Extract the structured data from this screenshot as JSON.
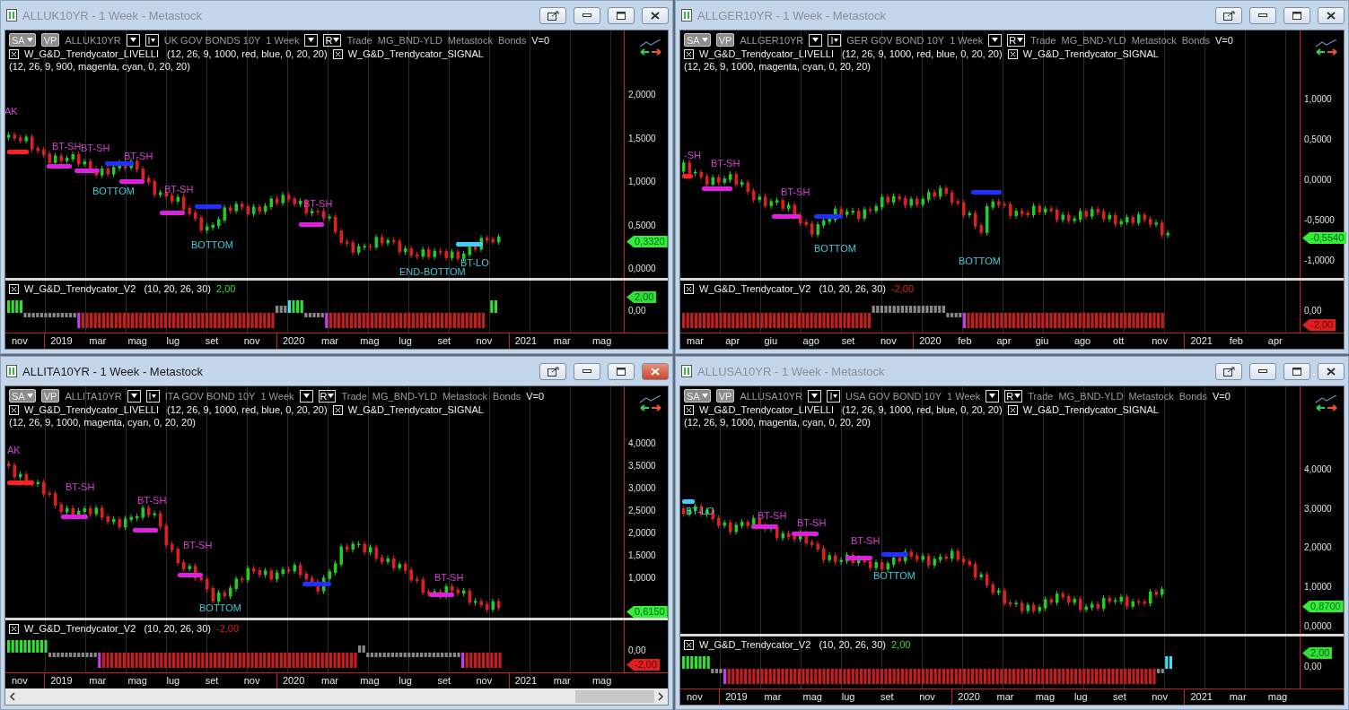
{
  "windows": [
    {
      "title": "ALLUK10YR - 1 Week - Metastock",
      "active": false,
      "scrollbar": false,
      "symbol_bar": {
        "sa": "SA",
        "vp": "VP",
        "symbol": "ALLUK10YR",
        "name": "UK GOV BONDS 10Y",
        "period": "1 Week",
        "r": "R",
        "tags": [
          "Trade",
          "MG_BND-YLD",
          "Metastock",
          "Bonds"
        ],
        "v": "V=0"
      },
      "indicators": [
        {
          "name": "W_G&D_Trendycator_LIVELLI",
          "params": "(12, 26, 9, 1000, red, blue, 0, 20, 20)"
        },
        {
          "name": "W_G&D_Trendycator_SIGNAL",
          "params": "(12, 26, 9, 900, magenta, cyan, 0, 20, 20)"
        }
      ],
      "price_axis": [
        "2,0000",
        "1,5000",
        "1,0000",
        "0,5000",
        "0,0000"
      ],
      "last_price": "0,3320",
      "annotations": [
        {
          "text": "AK",
          "color": "#d040d0"
        },
        {
          "text": "BT-SH",
          "color": "#d040d0"
        },
        {
          "text": "BT-SH",
          "color": "#d040d0"
        },
        {
          "text": "BT-SH",
          "color": "#d040d0"
        },
        {
          "text": "BOTTOM",
          "color": "#40c8d8"
        },
        {
          "text": "BT-SH",
          "color": "#d040d0"
        },
        {
          "text": "BOTTOM",
          "color": "#40c8d8"
        },
        {
          "text": "BT-SH",
          "color": "#d040d0"
        },
        {
          "text": "END-BOTTOM",
          "color": "#40c8d8"
        },
        {
          "text": "BT-LO",
          "color": "#40c8d8"
        }
      ],
      "oscillator": {
        "name": "W_G&D_Trendycator_V2",
        "params": "(10, 20, 26, 30)",
        "value": "2,00",
        "color": "#33dd33",
        "axis": "0,00",
        "badge": "2,00"
      },
      "months": [
        {
          "label": "nov",
          "kind": "month"
        },
        {
          "label": "2019",
          "kind": "year"
        },
        {
          "label": "mar",
          "kind": "month"
        },
        {
          "label": "mag",
          "kind": "month"
        },
        {
          "label": "lug",
          "kind": "month"
        },
        {
          "label": "set",
          "kind": "month"
        },
        {
          "label": "nov",
          "kind": "month"
        },
        {
          "label": "2020",
          "kind": "year"
        },
        {
          "label": "mar",
          "kind": "month"
        },
        {
          "label": "mag",
          "kind": "month"
        },
        {
          "label": "lug",
          "kind": "month"
        },
        {
          "label": "set",
          "kind": "month"
        },
        {
          "label": "nov",
          "kind": "month"
        },
        {
          "label": "2021",
          "kind": "year"
        },
        {
          "label": "mar",
          "kind": "month"
        },
        {
          "label": "mag",
          "kind": "month"
        }
      ]
    },
    {
      "title": "ALLGER10YR - 1 Week - Metastock",
      "active": false,
      "scrollbar": false,
      "symbol_bar": {
        "sa": "SA",
        "vp": "VP",
        "symbol": "ALLGER10YR",
        "name": "GER GOV BOND 10Y",
        "period": "1 Week",
        "r": "R",
        "tags": [
          "Trade",
          "MG_BND-YLD",
          "Metastock",
          "Bonds"
        ],
        "v": "V=0"
      },
      "indicators": [
        {
          "name": "W_G&D_Trendycator_LIVELLI",
          "params": "(12, 26, 9, 1000, red, blue, 0, 20, 20)"
        },
        {
          "name": "W_G&D_Trendycator_SIGNAL",
          "params": "(12, 26, 9, 1000, magenta, cyan, 0, 20, 20)"
        }
      ],
      "price_axis": [
        "1,0000",
        "0,5000",
        "0,0000",
        "-0,5000",
        "-1,0000"
      ],
      "last_price": "-0,5540",
      "annotations": [
        {
          "text": "-SH",
          "color": "#d040d0"
        },
        {
          "text": "BT-SH",
          "color": "#d040d0"
        },
        {
          "text": "BT-SH",
          "color": "#d040d0"
        },
        {
          "text": "BOTTOM",
          "color": "#40c8d8"
        },
        {
          "text": "BOTTOM",
          "color": "#40c8d8"
        }
      ],
      "oscillator": {
        "name": "W_G&D_Trendycator_V2",
        "params": "(10, 20, 26, 30)",
        "value": "-2,00",
        "color": "#e02020",
        "axis": "0,00",
        "badge": "-2,00"
      },
      "months": [
        {
          "label": "mar",
          "kind": "month"
        },
        {
          "label": "apr",
          "kind": "month"
        },
        {
          "label": "giu",
          "kind": "month"
        },
        {
          "label": "ago",
          "kind": "month"
        },
        {
          "label": "set",
          "kind": "month"
        },
        {
          "label": "nov",
          "kind": "month"
        },
        {
          "label": "2020",
          "kind": "year"
        },
        {
          "label": "feb",
          "kind": "month"
        },
        {
          "label": "apr",
          "kind": "month"
        },
        {
          "label": "giu",
          "kind": "month"
        },
        {
          "label": "ago",
          "kind": "month"
        },
        {
          "label": "ott",
          "kind": "month"
        },
        {
          "label": "nov",
          "kind": "month"
        },
        {
          "label": "2021",
          "kind": "year"
        },
        {
          "label": "feb",
          "kind": "month"
        },
        {
          "label": "apr",
          "kind": "month"
        }
      ]
    },
    {
      "title": "ALLITA10YR - 1 Week - Metastock",
      "active": true,
      "scrollbar": true,
      "symbol_bar": {
        "sa": "SA",
        "vp": "VP",
        "symbol": "ALLITA10YR",
        "name": "ITA GOV BOND 10Y",
        "period": "1 Week",
        "r": "R",
        "tags": [
          "Trade",
          "MG_BND-YLD",
          "Metastock",
          "Bonds"
        ],
        "v": "V=0"
      },
      "indicators": [
        {
          "name": "W_G&D_Trendycator_LIVELLI",
          "params": "(12, 26, 9, 1000, red, blue, 0, 20, 20)"
        },
        {
          "name": "W_G&D_Trendycator_SIGNAL",
          "params": "(12, 26, 9, 1000, magenta, cyan, 0, 20, 20)"
        }
      ],
      "price_axis": [
        "4,0000",
        "3,5000",
        "3,0000",
        "2,5000",
        "2,0000",
        "1,5000",
        "1,0000"
      ],
      "last_price": "0,6150",
      "annotations": [
        {
          "text": "AK",
          "color": "#d040d0"
        },
        {
          "text": "BT-SH",
          "color": "#d040d0"
        },
        {
          "text": "BT-SH",
          "color": "#d040d0"
        },
        {
          "text": "BT-SH",
          "color": "#d040d0"
        },
        {
          "text": "BOTTOM",
          "color": "#40c8d8"
        },
        {
          "text": "BT-SH",
          "color": "#d040d0"
        }
      ],
      "oscillator": {
        "name": "W_G&D_Trendycator_V2",
        "params": "(10, 20, 26, 30)",
        "value": "-2,00",
        "color": "#e02020",
        "axis": "0,00",
        "badge": "-2,00"
      },
      "months": [
        {
          "label": "nov",
          "kind": "month"
        },
        {
          "label": "2019",
          "kind": "year"
        },
        {
          "label": "mar",
          "kind": "month"
        },
        {
          "label": "mag",
          "kind": "month"
        },
        {
          "label": "lug",
          "kind": "month"
        },
        {
          "label": "set",
          "kind": "month"
        },
        {
          "label": "nov",
          "kind": "month"
        },
        {
          "label": "2020",
          "kind": "year"
        },
        {
          "label": "mar",
          "kind": "month"
        },
        {
          "label": "mag",
          "kind": "month"
        },
        {
          "label": "lug",
          "kind": "month"
        },
        {
          "label": "set",
          "kind": "month"
        },
        {
          "label": "nov",
          "kind": "month"
        },
        {
          "label": "2021",
          "kind": "year"
        },
        {
          "label": "mar",
          "kind": "month"
        },
        {
          "label": "mag",
          "kind": "month"
        }
      ]
    },
    {
      "title": "ALLUSA10YR - 1 Week - Metastock",
      "active": false,
      "scrollbar": false,
      "symbol_bar": {
        "sa": "SA",
        "vp": "VP",
        "symbol": "ALLUSA10YR",
        "name": "USA GOV BOND 10Y",
        "period": "1 Week",
        "r": "R",
        "tags": [
          "Trade",
          "MG_BND-YLD",
          "Metastock",
          "Bonds"
        ],
        "v": "V=0"
      },
      "indicators": [
        {
          "name": "W_G&D_Trendycator_LIVELLI",
          "params": "(12, 26, 9, 1000, red, blue, 0, 20, 20)"
        },
        {
          "name": "W_G&D_Trendycator_SIGNAL",
          "params": "(12, 26, 9, 1000, magenta, cyan, 0, 20, 20)"
        }
      ],
      "price_axis": [
        "4,0000",
        "3,0000",
        "2,0000",
        "1,0000",
        "0,0000"
      ],
      "last_price": "0,8700",
      "annotations": [
        {
          "text": "BT-LO",
          "color": "#40c8d8"
        },
        {
          "text": "BT-SH",
          "color": "#d040d0"
        },
        {
          "text": "BT-SH",
          "color": "#d040d0"
        },
        {
          "text": "BT-SH",
          "color": "#d040d0"
        },
        {
          "text": "BOTTOM",
          "color": "#40c8d8"
        }
      ],
      "oscillator": {
        "name": "W_G&D_Trendycator_V2",
        "params": "(10, 20, 26, 30)",
        "value": "2,00",
        "color": "#33dd33",
        "axis": "0,00",
        "badge": "2,00"
      },
      "months": [
        {
          "label": "nov",
          "kind": "month"
        },
        {
          "label": "2019",
          "kind": "year"
        },
        {
          "label": "mar",
          "kind": "month"
        },
        {
          "label": "mag",
          "kind": "month"
        },
        {
          "label": "lug",
          "kind": "month"
        },
        {
          "label": "set",
          "kind": "month"
        },
        {
          "label": "nov",
          "kind": "month"
        },
        {
          "label": "2020",
          "kind": "year"
        },
        {
          "label": "mar",
          "kind": "month"
        },
        {
          "label": "mag",
          "kind": "month"
        },
        {
          "label": "lug",
          "kind": "month"
        },
        {
          "label": "set",
          "kind": "month"
        },
        {
          "label": "nov",
          "kind": "month"
        },
        {
          "label": "2021",
          "kind": "year"
        },
        {
          "label": "mar",
          "kind": "month"
        },
        {
          "label": "mag",
          "kind": "month"
        }
      ]
    }
  ]
}
